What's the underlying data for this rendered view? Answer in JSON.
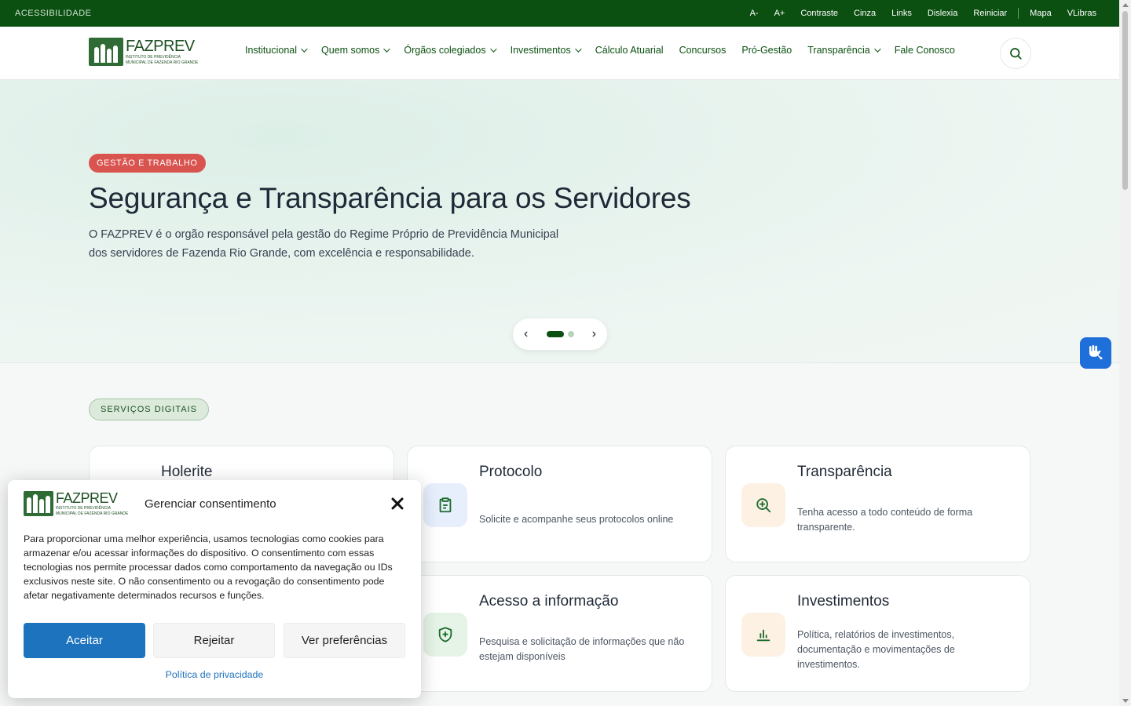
{
  "accessibility_bar": {
    "title": "ACESSIBILIDADE",
    "links": [
      "A-",
      "A+",
      "Contraste",
      "Cinza",
      "Links",
      "Dislexia",
      "Reiniciar"
    ],
    "links_right": [
      "Mapa",
      "VLibras"
    ]
  },
  "logo": {
    "name": "FAZPREV",
    "sub_line1": "INSTITUTO DE PREVIDÊNCIA",
    "sub_line2": "MUNICIPAL DE FAZENDA RIO GRANDE"
  },
  "nav": {
    "items": [
      {
        "label": "Institucional",
        "has_dropdown": true
      },
      {
        "label": "Quem somos",
        "has_dropdown": true
      },
      {
        "label": "Órgãos colegiados",
        "has_dropdown": true
      },
      {
        "label": "Investimentos",
        "has_dropdown": true
      },
      {
        "label": "Cálculo Atuarial",
        "has_dropdown": false
      },
      {
        "label": "Concursos",
        "has_dropdown": false
      },
      {
        "label": "Pró-Gestão",
        "has_dropdown": false
      },
      {
        "label": "Transparência",
        "has_dropdown": true
      },
      {
        "label": "Fale Conosco",
        "has_dropdown": false
      }
    ],
    "search_icon": "search-icon"
  },
  "hero": {
    "badge": "GESTÃO E TRABALHO",
    "title": "Segurança e Transparência para os Servidores",
    "description": "O FAZPREV é o orgão responsável pela gestão do Regime Próprio de Previdência Municipal dos servidores de Fazenda Rio Grande, com excelência e responsabilidade.",
    "carousel": {
      "prev": "‹",
      "next": "›",
      "slides": 2,
      "active": 1
    }
  },
  "services": {
    "badge": "SERVIÇOS DIGITAIS",
    "cards": [
      {
        "title": "Holerite",
        "description": "",
        "icon": "payslip-icon",
        "accent": "#e8f5ea"
      },
      {
        "title": "Protocolo",
        "description": "Solicite e acompanhe seus protocolos online",
        "icon": "clipboard-icon",
        "accent": "#e7eefc"
      },
      {
        "title": "Transparência",
        "description": "Tenha acesso a todo conteúdo de forma transparente.",
        "icon": "zoom-in-icon",
        "accent": "#fdf1e4"
      },
      {
        "title": "Acesso a informação",
        "description": "Pesquisa e solicitação de informações que não estejam disponíveis",
        "icon": "shield-plus-icon",
        "accent": "#e6f4e8"
      },
      {
        "title": "Investimentos",
        "description": "Política, relatórios de investimentos, documentação e movimentações de investimentos.",
        "icon": "bar-chart-icon",
        "accent": "#fdf1e4"
      }
    ]
  },
  "cookie": {
    "title": "Gerenciar consentimento",
    "text": "Para proporcionar uma melhor experiência, usamos tecnologias como cookies para armazenar e/ou acessar informações do dispositivo. O consentimento com essas tecnologias nos permite processar dados como comportamento da navegação ou IDs exclusivos neste site. O não consentimento ou a revogação do consentimento pode afetar negativamente determinados recursos e funções.",
    "accept": "Aceitar",
    "reject": "Rejeitar",
    "preferences": "Ver preferências",
    "policy": "Política de privacidade"
  },
  "colors": {
    "primary": "#0b5011",
    "hero_badge": "#d9534f",
    "accept": "#1e73be",
    "libras": "#1e6fd9"
  }
}
